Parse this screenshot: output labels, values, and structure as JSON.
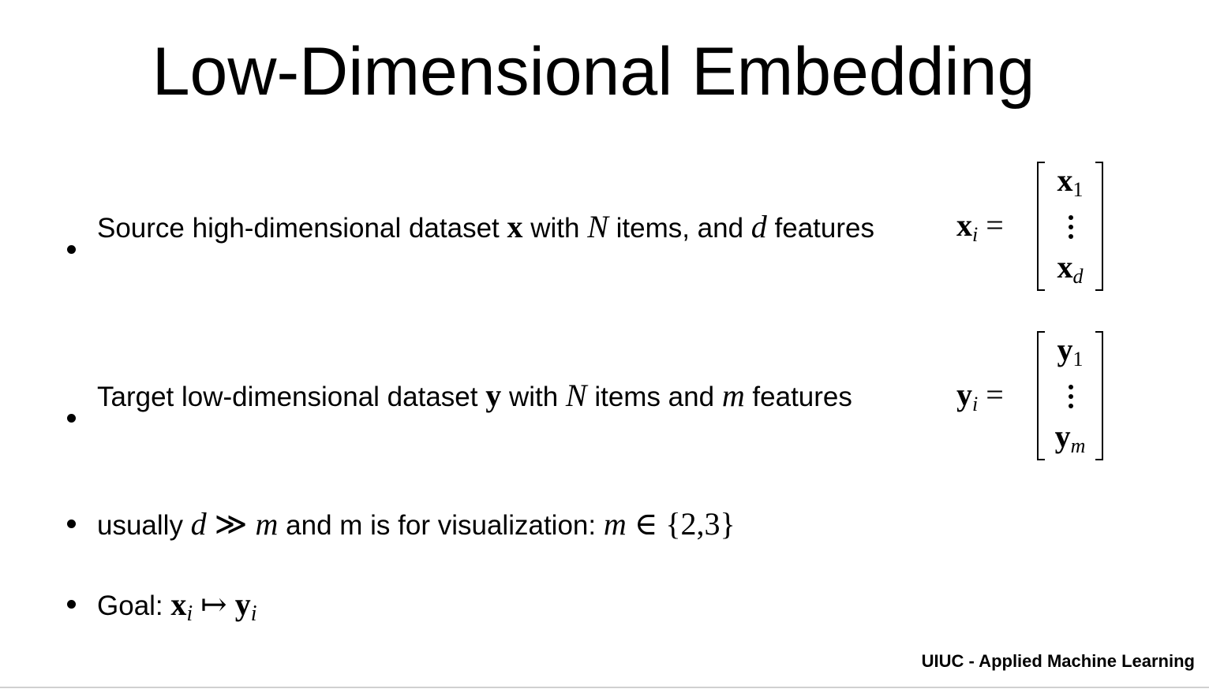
{
  "title": "Low-Dimensional Embedding",
  "bullets": [
    {
      "t1": "Source high-dimensional dataset ",
      "v1": "x",
      "t2": " with ",
      "v2": "N",
      "t3": " items, and ",
      "v3": "d",
      "t4": " features ",
      "lhs": "x",
      "lhs_sub": "i",
      "eq": "=",
      "top": "x",
      "top_sub": "1",
      "bottom": "x",
      "bottom_sub": "d"
    },
    {
      "t1": "Target low-dimensional dataset ",
      "v1": "y",
      "t2": " with ",
      "v2": "N",
      "t3": " items and ",
      "v3": "m",
      "t4": " features",
      "lhs": "y",
      "lhs_sub": "i",
      "eq": "=",
      "top": "y",
      "top_sub": "1",
      "bottom": "y",
      "bottom_sub": "m"
    },
    {
      "t1": "usually ",
      "v1": "d",
      "op": " ≫ ",
      "v2": "m",
      "t2": " and m is for visualization: ",
      "v3": "m",
      "set": " ∈ {2,3}"
    },
    {
      "t1": "Goal: ",
      "v1": "x",
      "s1": "i",
      "op": " ↦ ",
      "v2": "y",
      "s2": "i"
    }
  ],
  "footer": "UIUC - Applied Machine Learning"
}
